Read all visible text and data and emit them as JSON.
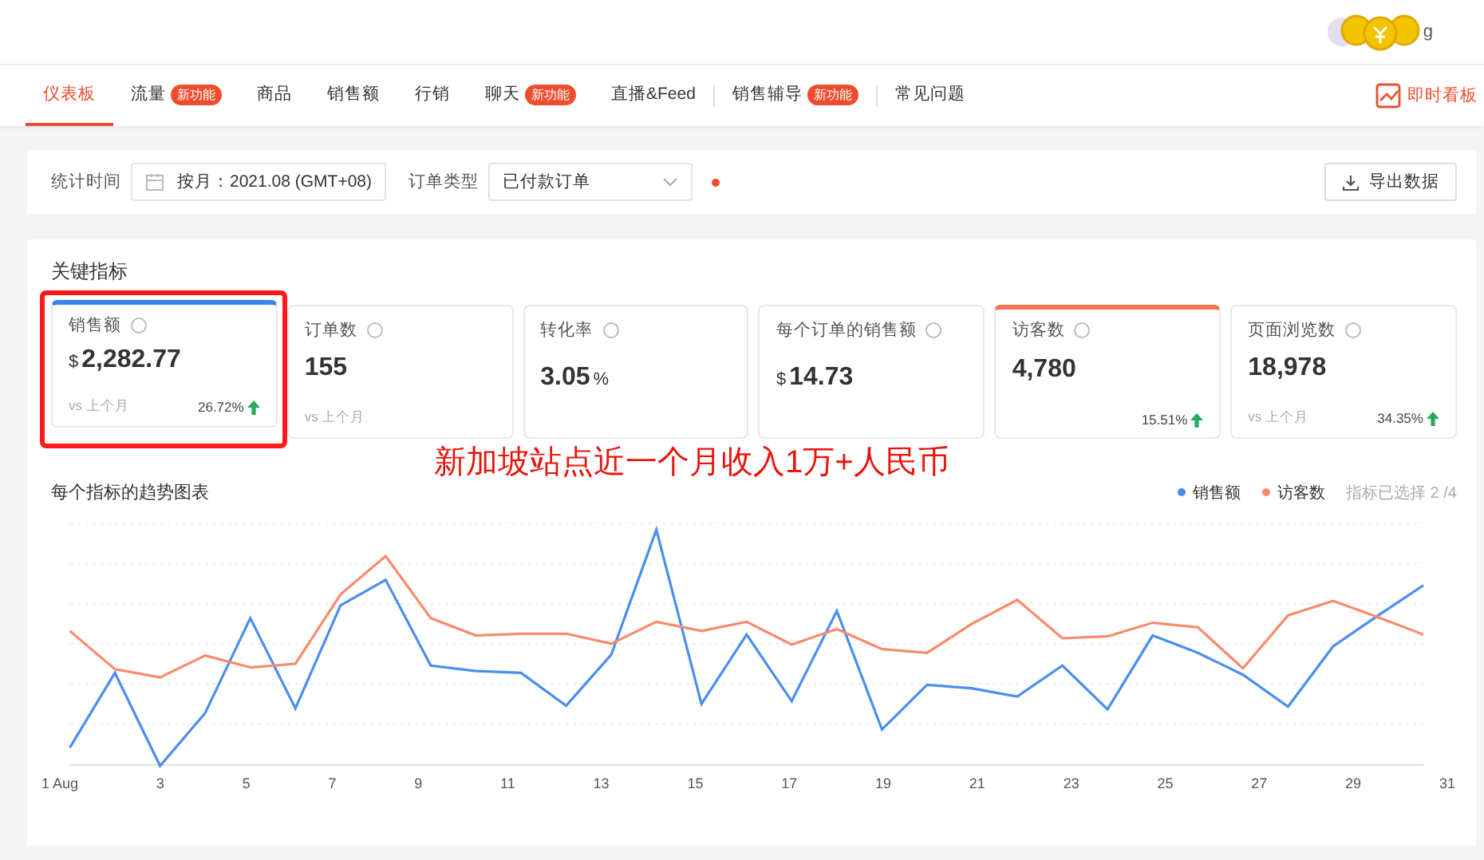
{
  "header": {
    "user_fragment": "g"
  },
  "tabs": [
    {
      "label": "仪表板",
      "selected": true
    },
    {
      "label": "流量",
      "badge": "新功能",
      "selected": false
    },
    {
      "label": "商品",
      "selected": false
    },
    {
      "label": "销售额",
      "selected": false
    },
    {
      "label": "行销",
      "selected": false
    },
    {
      "label": "聊天",
      "badge": "新功能",
      "selected": false
    },
    {
      "label": "直播&Feed",
      "selected": false,
      "divider_after": true
    },
    {
      "label": "销售辅导",
      "badge": "新功能",
      "selected": false,
      "divider_after": true
    },
    {
      "label": "常见问题",
      "selected": false
    }
  ],
  "realtime_link": "即时看板",
  "filters": {
    "period_label": "统计时间",
    "period_value": "按月：2021.08 (GMT+08)",
    "order_type_label": "订单类型",
    "order_type_value": "已付款订单",
    "export_button": "导出数据"
  },
  "metrics": {
    "title": "关键指标",
    "cards": [
      {
        "label": "销售额",
        "currency": "$",
        "value": "2,282.77",
        "compare": "vs 上个月",
        "change": "26.72%",
        "selected": true,
        "color": "#3b7ff2",
        "highlighted": true
      },
      {
        "label": "订单数",
        "value": "155",
        "compare": "vs 上个月",
        "selected": false,
        "highlighted": false
      },
      {
        "label": "转化率",
        "value": "3.05",
        "unit": "%",
        "selected": false,
        "highlighted": false
      },
      {
        "label": "每个订单的销售额",
        "currency": "$",
        "value": "14.73",
        "selected": false,
        "highlighted": false
      },
      {
        "label": "访客数",
        "value": "4,780",
        "change": "15.51%",
        "selected": true,
        "color": "#f7734f",
        "highlighted": false
      },
      {
        "label": "页面浏览数",
        "value": "18,978",
        "compare": "vs 上个月",
        "change": "34.35%",
        "selected": false,
        "highlighted": false
      }
    ]
  },
  "annotation": "新加坡站点近一个月收入1万+人民币",
  "trend": {
    "title": "每个指标的趋势图表",
    "legend": [
      {
        "label": "销售额",
        "color": "#4a8ef0"
      },
      {
        "label": "访客数",
        "color": "#fa8a6c"
      }
    ],
    "selection_note": "指标已选择 2 /4",
    "x_labels": [
      "1 Aug",
      "3",
      "5",
      "7",
      "9",
      "11",
      "13",
      "15",
      "17",
      "19",
      "21",
      "23",
      "25",
      "27",
      "29",
      "31"
    ]
  }
}
